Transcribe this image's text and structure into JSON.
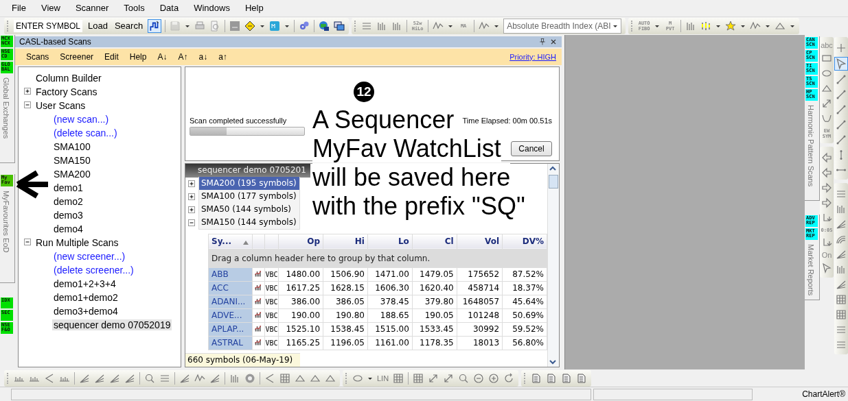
{
  "menu": [
    "File",
    "View",
    "Scanner",
    "Tools",
    "Data",
    "Windows",
    "Help"
  ],
  "toolbar": {
    "symbol_field": {
      "value": "ENTER SYMBOL"
    },
    "buttons": [
      "Load",
      "Search"
    ],
    "step_chart_selected": true,
    "save_disabled": true,
    "hilo_label": "52w HiLo",
    "ma_label": "MA",
    "indicator_combo": {
      "value": "Absolute Breadth Index (ABI"
    },
    "fibo_label": "AUTO FIBO",
    "pivot_label": "M PVT"
  },
  "left_strip": {
    "top_badges": [
      "MCX NCX",
      "NSE CD",
      "GLO BAL"
    ],
    "top_label": "Global Exchanges",
    "fav_badge": "My Fav",
    "fav_label": "MyFavourites EoD",
    "bottom_badges": [
      "IDX",
      "SEC",
      "NSE F&O"
    ]
  },
  "panel": {
    "title": "CASL-based Scans",
    "menu": [
      "Scans",
      "Screener",
      "Edit",
      "Help"
    ],
    "sort_buttons": [
      "A↓",
      "A↑",
      "a↓",
      "a↑"
    ],
    "priority": "Priority: HIGH"
  },
  "tree": [
    {
      "label": "Column Builder",
      "kind": "item",
      "selected": false
    },
    {
      "label": "Factory Scans",
      "kind": "item",
      "selected": false,
      "expanded": false
    },
    {
      "label": "User Scans",
      "kind": "item",
      "selected": false,
      "expanded": true,
      "children": [
        {
          "label": "(new scan...)",
          "kind": "link",
          "selected": false
        },
        {
          "label": "(delete scan...)",
          "kind": "link",
          "selected": false
        },
        {
          "label": "SMA100",
          "kind": "item",
          "selected": false
        },
        {
          "label": "SMA150",
          "kind": "item",
          "selected": false
        },
        {
          "label": "SMA200",
          "kind": "item",
          "selected": false
        },
        {
          "label": "demo1",
          "kind": "item",
          "selected": false
        },
        {
          "label": "demo2",
          "kind": "item",
          "selected": false
        },
        {
          "label": "demo3",
          "kind": "item",
          "selected": false
        },
        {
          "label": "demo4",
          "kind": "item",
          "selected": false
        }
      ]
    },
    {
      "label": "Run Multiple Scans",
      "kind": "item",
      "selected": false,
      "expanded": true,
      "children": [
        {
          "label": "(new screener...)",
          "kind": "link",
          "selected": false
        },
        {
          "label": "(delete screener...)",
          "kind": "link",
          "selected": false
        },
        {
          "label": "demo1+2+3+4",
          "kind": "item",
          "selected": false
        },
        {
          "label": "demo1+demo2",
          "kind": "item",
          "selected": false
        },
        {
          "label": "demo3+demo4",
          "kind": "item",
          "selected": false
        },
        {
          "label": "sequencer demo 07052019",
          "kind": "item",
          "selected": true
        }
      ]
    }
  ],
  "scan_status": {
    "message": "Scan completed successfully",
    "progress": {
      "level": 0.32
    },
    "time_elapsed": "Time Elapsed: 00m 00.51s",
    "cancel": "Cancel"
  },
  "results": {
    "tab": "sequencer demo 0705201",
    "groups": [
      {
        "label": "SMA200 (195 symbols)",
        "expanded": false,
        "selected": true
      },
      {
        "label": "SMA100 (177 symbols)",
        "expanded": false,
        "selected": false
      },
      {
        "label": "SMA50 (144 symbols)",
        "expanded": false,
        "selected": false
      },
      {
        "label": "SMA150 (144 symbols)",
        "expanded": true,
        "selected": false
      }
    ],
    "columns": [
      {
        "label": "Sy...",
        "sorted": true
      },
      {
        "label": "Op",
        "sorted": false
      },
      {
        "label": "Hi",
        "sorted": false
      },
      {
        "label": "Lo",
        "sorted": false
      },
      {
        "label": "Cl",
        "sorted": false
      },
      {
        "label": "Vol",
        "sorted": false
      },
      {
        "label": "DV%",
        "sorted": false
      }
    ],
    "group_hint": "Drag a column header here to group by that column.",
    "rows": [
      {
        "symbol": "ABB",
        "tag": "VBC",
        "values": [
          "1480.00",
          "1506.90",
          "1471.00",
          "1479.05",
          "175652",
          "87.52%"
        ]
      },
      {
        "symbol": "ACC",
        "tag": "VBC",
        "values": [
          "1617.25",
          "1628.15",
          "1606.30",
          "1620.40",
          "458714",
          "18.37%"
        ]
      },
      {
        "symbol": "ADANI...",
        "tag": "VBC",
        "values": [
          "386.00",
          "386.05",
          "378.45",
          "379.80",
          "1648057",
          "45.64%"
        ]
      },
      {
        "symbol": "ADVE...",
        "tag": "VBC",
        "values": [
          "190.00",
          "190.80",
          "188.65",
          "190.05",
          "101248",
          "50.69%"
        ]
      },
      {
        "symbol": "APLAP...",
        "tag": "VBC",
        "values": [
          "1525.10",
          "1538.45",
          "1515.00",
          "1533.45",
          "30992",
          "59.52%"
        ]
      },
      {
        "symbol": "ASTRAL",
        "tag": "VBC",
        "values": [
          "1165.25",
          "1196.05",
          "1161.00",
          "1178.35",
          "18013",
          "56.80%"
        ]
      }
    ],
    "footer": "660 symbols (06-May-19)"
  },
  "annotation": {
    "number": "12",
    "lines": [
      "A Sequencer",
      "MyFav WatchList",
      "will be saved here",
      "with the prefix \"SQ\""
    ]
  },
  "right_strip": {
    "badges": [
      "CAN SCN",
      "CP SCN",
      "TI SCN",
      "TS SCN",
      "HP SCN"
    ],
    "label": "Harmonic Pattern Scans",
    "report_badges": [
      "ADV REP",
      "MKT REP"
    ],
    "report_label": "Market Reports"
  },
  "drawing_tools": {
    "text_tool": "abc",
    "wave_tool": "EW SYM",
    "time_tool": "0:05",
    "on_tool": "On",
    "pointer_selected": true
  },
  "bottom_toolbar": {
    "line_tool": "LIN"
  },
  "status_bar": {
    "app_name": "ChartAlert®"
  }
}
